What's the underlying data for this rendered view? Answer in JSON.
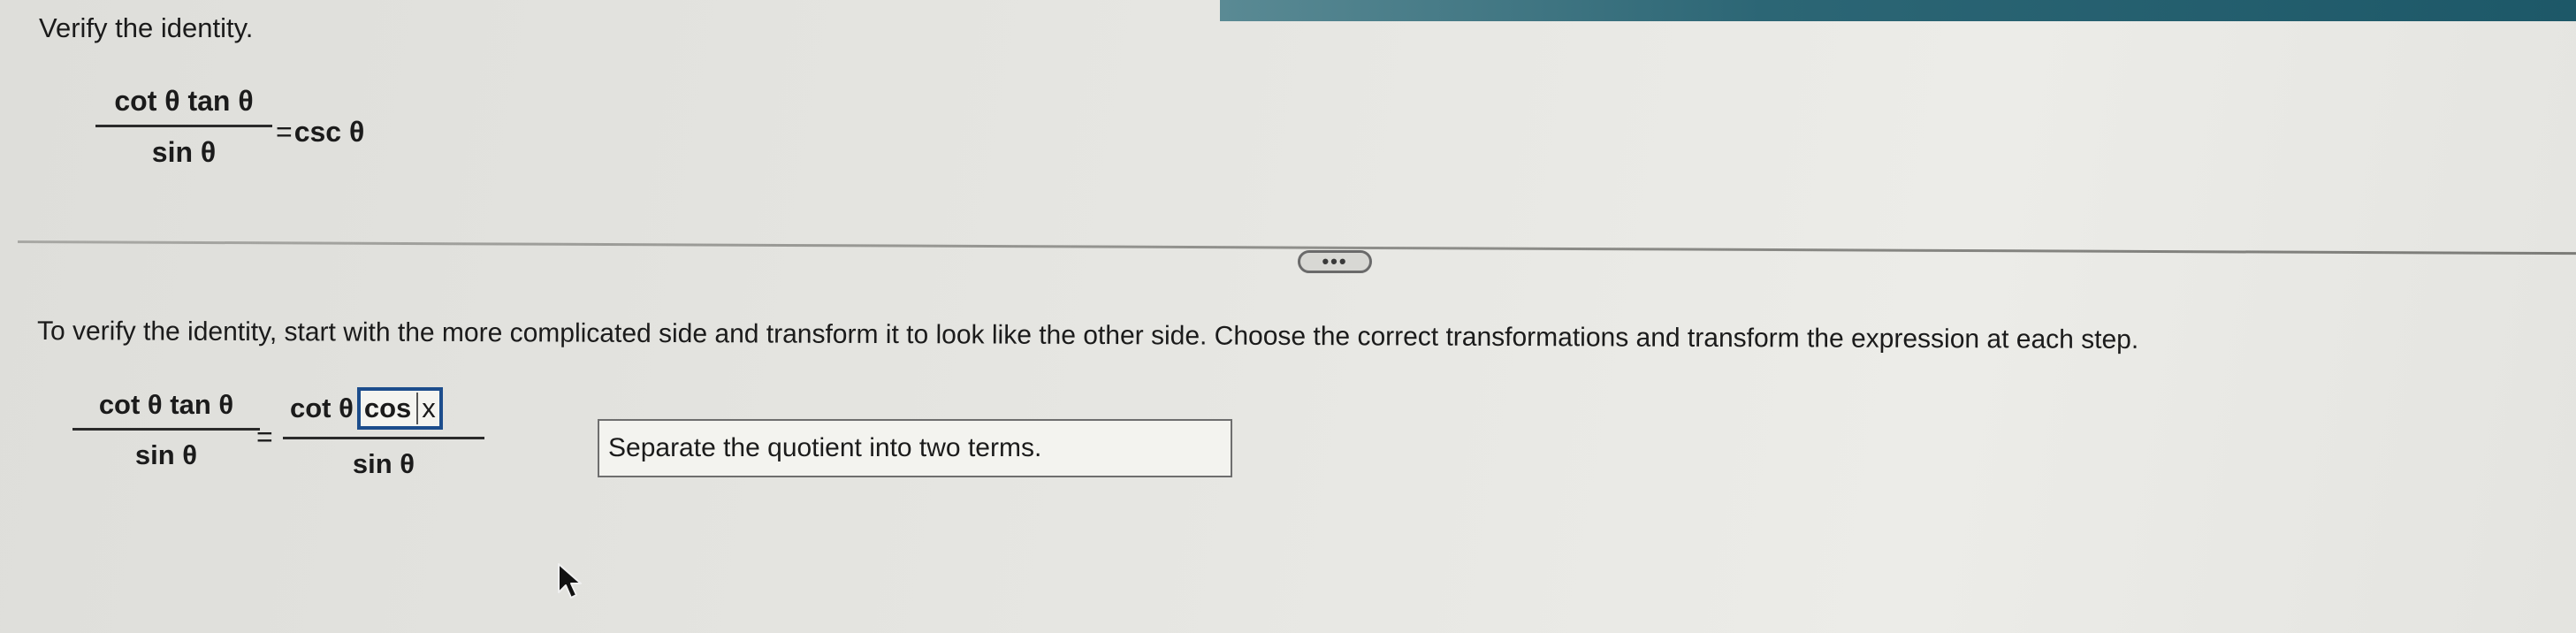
{
  "prompt": "Verify the identity.",
  "given": {
    "numerator": "cot θ tan θ",
    "denominator": "sin θ",
    "equals": "=",
    "rhs": "csc θ"
  },
  "more_button": {
    "label": "•••"
  },
  "instruction": "To verify the identity, start with the more complicated side and transform it to look like the other side. Choose the correct transformations and transform the expression at each step.",
  "step": {
    "lhs_numerator": "cot θ tan θ",
    "lhs_denominator": "sin θ",
    "equals": "=",
    "rhs_numerator_prefix": "cot θ",
    "blank_value": "cos",
    "blank_typed": "x",
    "rhs_denominator": "sin θ"
  },
  "reason": {
    "selected": "Separate the quotient into two terms."
  },
  "colors": {
    "top_bar": "#2c6675",
    "blank_border": "#1c4d8c"
  },
  "icons": {
    "cursor": "mouse-pointer-icon"
  }
}
